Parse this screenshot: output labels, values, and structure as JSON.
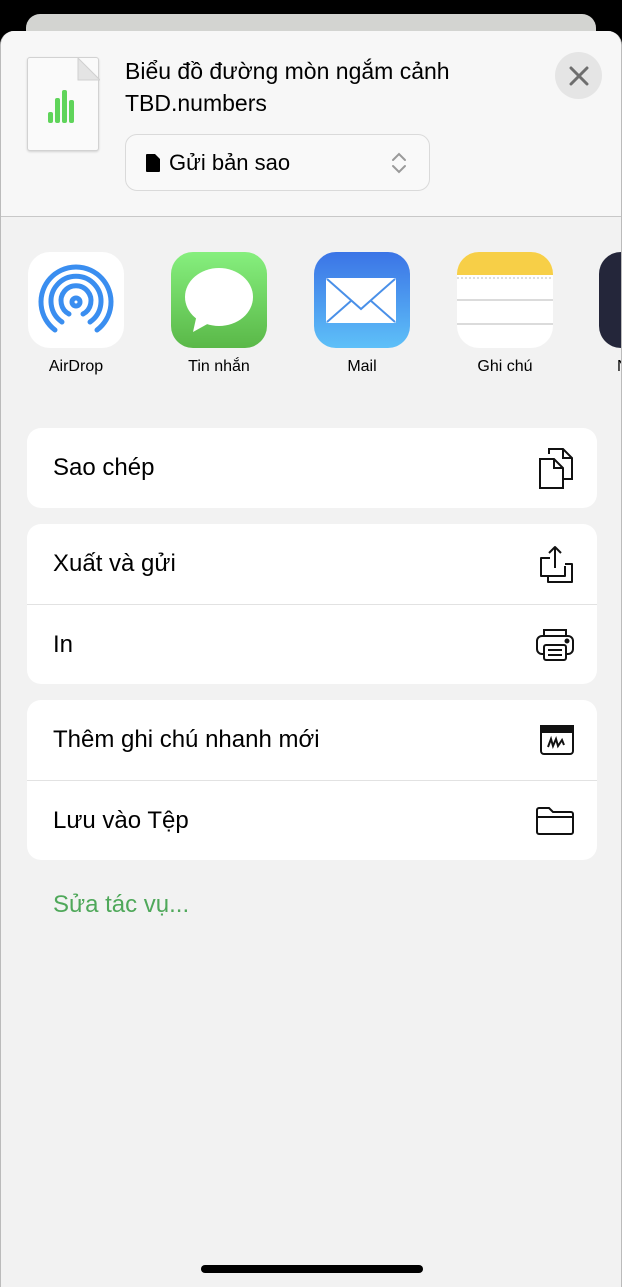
{
  "file": {
    "title": "Biểu đồ đường mòn ngắm cảnh TBD.numbers",
    "icon": "numbers-document-icon"
  },
  "send_mode": {
    "value": "Gửi bản sao",
    "icon": "document-icon"
  },
  "close_icon": "close-icon",
  "apps": [
    {
      "label": "AirDrop",
      "icon": "airdrop-icon"
    },
    {
      "label": "Tin nhắn",
      "icon": "messages-icon"
    },
    {
      "label": "Mail",
      "icon": "mail-icon"
    },
    {
      "label": "Ghi chú",
      "icon": "notes-icon"
    },
    {
      "label": "N",
      "icon": "app-icon"
    }
  ],
  "actions": [
    [
      {
        "label": "Sao chép",
        "icon": "copy-icon"
      }
    ],
    [
      {
        "label": "Xuất và gửi",
        "icon": "export-icon"
      },
      {
        "label": "In",
        "icon": "print-icon"
      }
    ],
    [
      {
        "label": "Thêm ghi chú nhanh mới",
        "icon": "quick-note-icon"
      },
      {
        "label": "Lưu vào Tệp",
        "icon": "folder-icon"
      }
    ]
  ],
  "edit_actions": "Sửa tác vụ...",
  "colors": {
    "accent": "#4fa85a"
  }
}
